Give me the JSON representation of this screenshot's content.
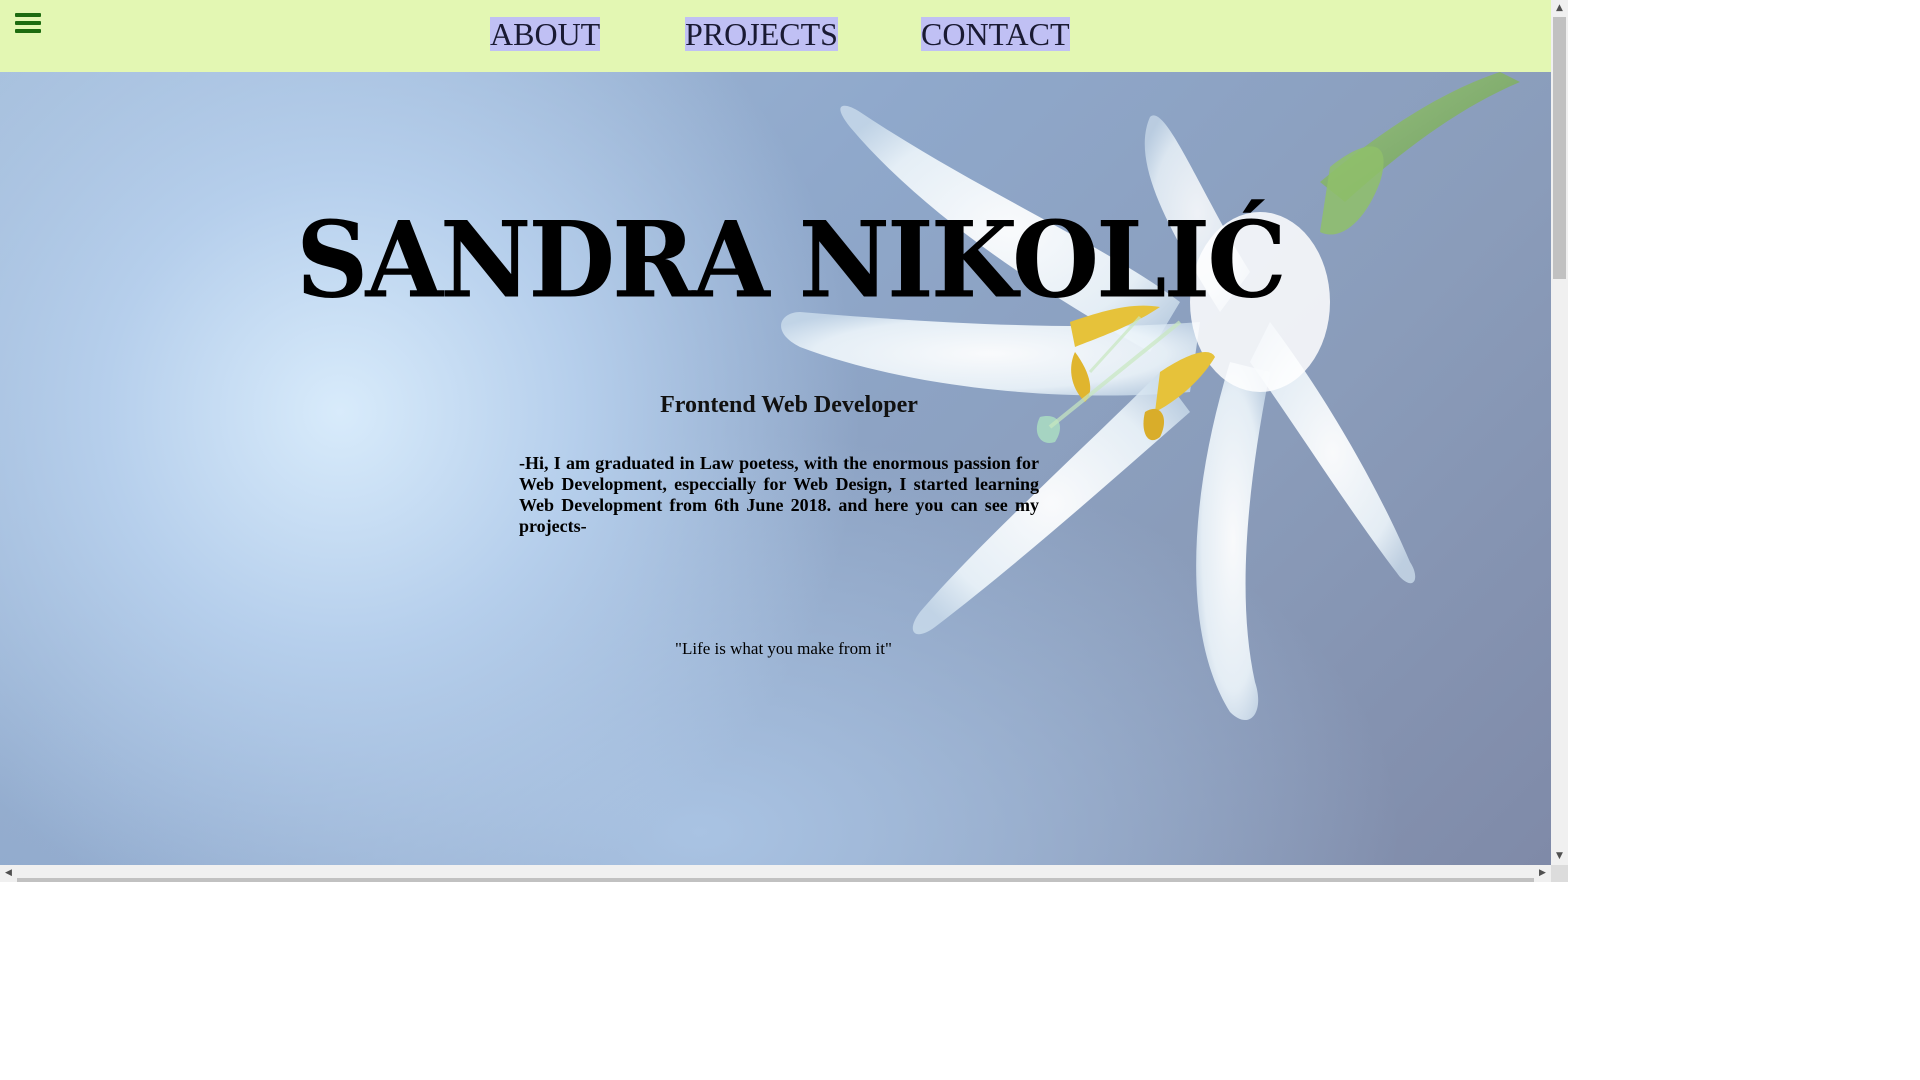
{
  "nav": {
    "menu_icon": "hamburger-menu-icon",
    "links": [
      {
        "label": "ABOUT"
      },
      {
        "label": "PROJECTS"
      },
      {
        "label": "CONTACT"
      }
    ],
    "bar_color": "#e3f7b3",
    "link_highlight_color": "#c0c0f4"
  },
  "hero": {
    "name": "SANDRA NIKOLIĆ",
    "role": "Frontend Web Developer",
    "about": "-Hi, I am graduated in Law poetess, with the enormous passion for Web Development, especcially for Web Design, I started learning Web Development from 6th June 2018. and here you can see my projects-",
    "quote": "\"Life is what you make from it\"",
    "background_image": "white-lily-flower"
  },
  "scrollbars": {
    "up_icon": "▲",
    "down_icon": "▼",
    "left_icon": "◀",
    "right_icon": "▶"
  }
}
